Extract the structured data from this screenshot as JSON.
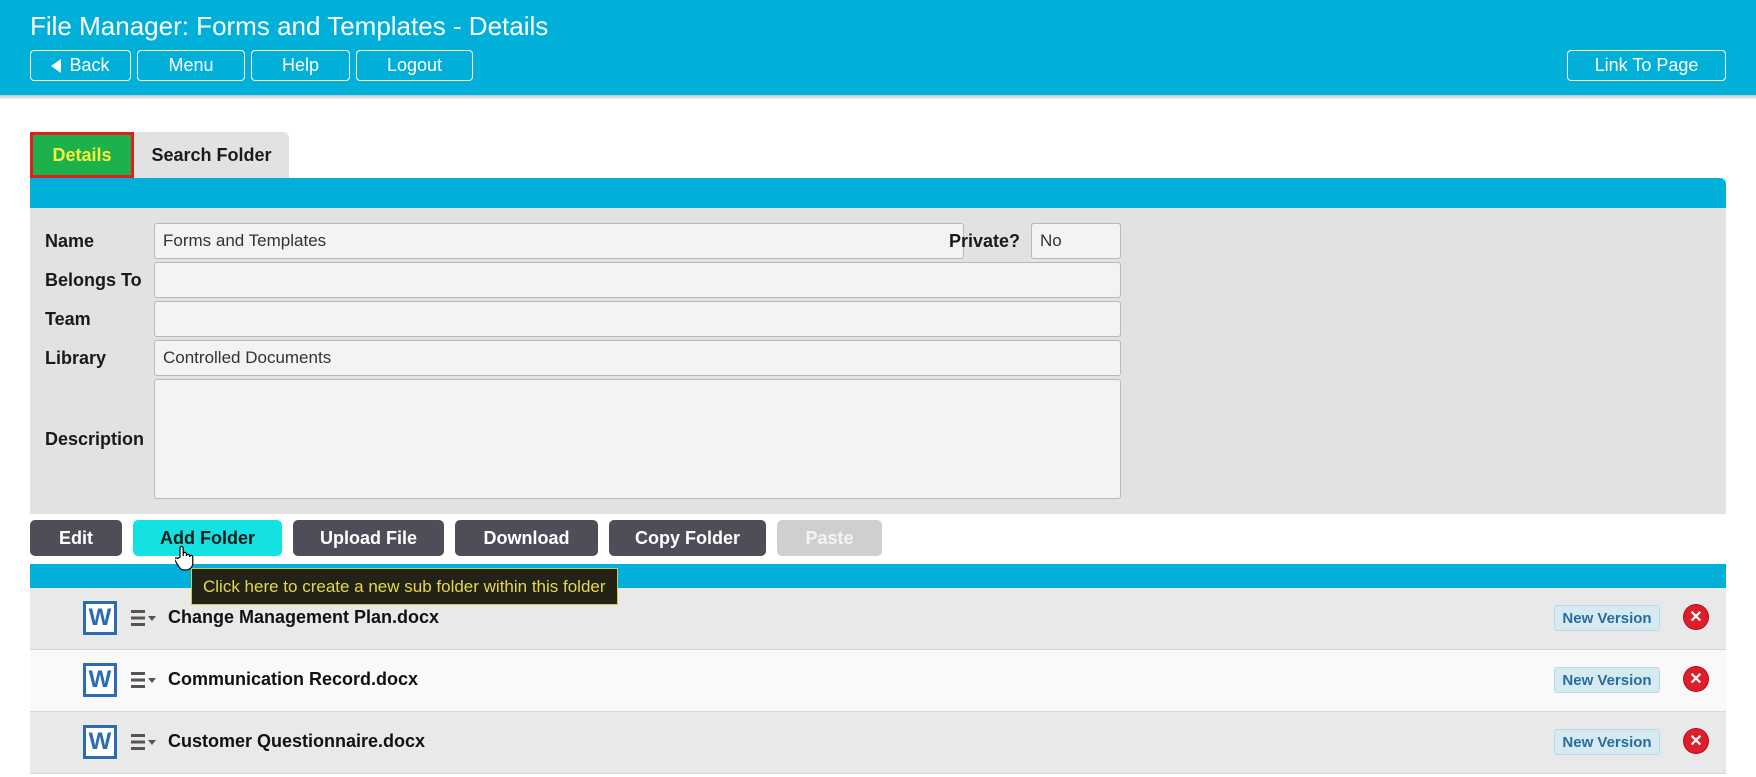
{
  "header": {
    "title": "File Manager: Forms and Templates - Details",
    "buttons": {
      "back": "Back",
      "menu": "Menu",
      "help": "Help",
      "logout": "Logout",
      "link_to_page": "Link To Page"
    }
  },
  "tabs": {
    "details": "Details",
    "search_folder": "Search Folder"
  },
  "form": {
    "name_label": "Name",
    "name_value": "Forms and Templates",
    "private_label": "Private?",
    "private_value": "No",
    "belongs_to_label": "Belongs To",
    "belongs_to_value": "",
    "team_label": "Team",
    "team_value": "",
    "library_label": "Library",
    "library_value": "Controlled Documents",
    "description_label": "Description",
    "description_value": ""
  },
  "actions": {
    "edit": "Edit",
    "add_folder": "Add Folder",
    "upload_file": "Upload File",
    "download": "Download",
    "copy_folder": "Copy Folder",
    "paste": "Paste"
  },
  "tooltip": "Click here to create a new sub folder within this folder",
  "files": [
    {
      "name": "Change Management Plan.docx",
      "icon": "word-icon",
      "new_version": "New Version"
    },
    {
      "name": "Communication Record.docx",
      "icon": "word-icon",
      "new_version": "New Version"
    },
    {
      "name": "Customer Questionnaire.docx",
      "icon": "word-icon",
      "new_version": "New Version"
    }
  ],
  "colors": {
    "header": "#00b0d8",
    "active_tab": "#1db14c",
    "active_tab_text": "#f6f03a",
    "highlight_border": "#e51d1d",
    "button_dark": "#4d4e58",
    "button_hover": "#14e2e2",
    "delete": "#dc1f2a"
  }
}
